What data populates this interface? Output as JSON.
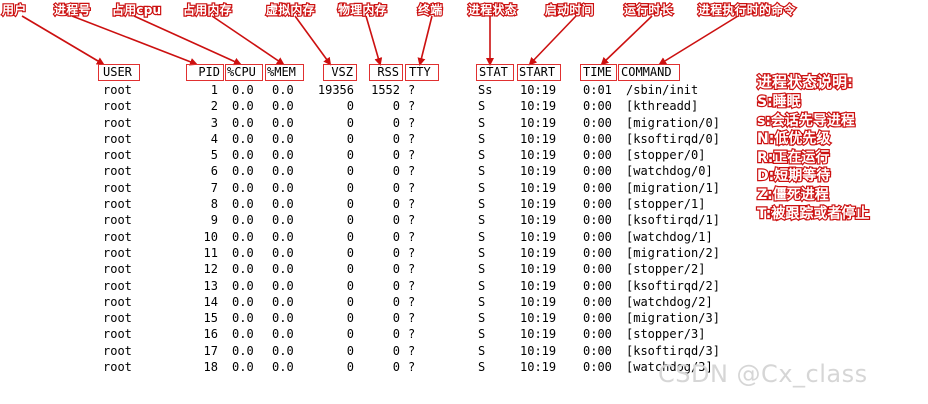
{
  "annotations": [
    "用户",
    "进程号",
    "占用cpu",
    "占用内存",
    "虚拟内存",
    "物理内存",
    "终端",
    "进程状态",
    "启动时间",
    "运行时长",
    "进程执行时的命令"
  ],
  "columns": [
    "USER",
    "PID",
    "%CPU",
    "%MEM",
    "VSZ",
    "RSS",
    "TTY",
    "STAT",
    "START",
    "TIME",
    "COMMAND"
  ],
  "rows": [
    {
      "user": "root",
      "pid": "1",
      "cpu": "0.0",
      "mem": "0.0",
      "vsz": "19356",
      "rss": "1552",
      "tty": "?",
      "stat": "Ss",
      "start": "10:19",
      "time": "0:01",
      "command": "/sbin/init"
    },
    {
      "user": "root",
      "pid": "2",
      "cpu": "0.0",
      "mem": "0.0",
      "vsz": "0",
      "rss": "0",
      "tty": "?",
      "stat": "S",
      "start": "10:19",
      "time": "0:00",
      "command": "[kthreadd]"
    },
    {
      "user": "root",
      "pid": "3",
      "cpu": "0.0",
      "mem": "0.0",
      "vsz": "0",
      "rss": "0",
      "tty": "?",
      "stat": "S",
      "start": "10:19",
      "time": "0:00",
      "command": "[migration/0]"
    },
    {
      "user": "root",
      "pid": "4",
      "cpu": "0.0",
      "mem": "0.0",
      "vsz": "0",
      "rss": "0",
      "tty": "?",
      "stat": "S",
      "start": "10:19",
      "time": "0:00",
      "command": "[ksoftirqd/0]"
    },
    {
      "user": "root",
      "pid": "5",
      "cpu": "0.0",
      "mem": "0.0",
      "vsz": "0",
      "rss": "0",
      "tty": "?",
      "stat": "S",
      "start": "10:19",
      "time": "0:00",
      "command": "[stopper/0]"
    },
    {
      "user": "root",
      "pid": "6",
      "cpu": "0.0",
      "mem": "0.0",
      "vsz": "0",
      "rss": "0",
      "tty": "?",
      "stat": "S",
      "start": "10:19",
      "time": "0:00",
      "command": "[watchdog/0]"
    },
    {
      "user": "root",
      "pid": "7",
      "cpu": "0.0",
      "mem": "0.0",
      "vsz": "0",
      "rss": "0",
      "tty": "?",
      "stat": "S",
      "start": "10:19",
      "time": "0:00",
      "command": "[migration/1]"
    },
    {
      "user": "root",
      "pid": "8",
      "cpu": "0.0",
      "mem": "0.0",
      "vsz": "0",
      "rss": "0",
      "tty": "?",
      "stat": "S",
      "start": "10:19",
      "time": "0:00",
      "command": "[stopper/1]"
    },
    {
      "user": "root",
      "pid": "9",
      "cpu": "0.0",
      "mem": "0.0",
      "vsz": "0",
      "rss": "0",
      "tty": "?",
      "stat": "S",
      "start": "10:19",
      "time": "0:00",
      "command": "[ksoftirqd/1]"
    },
    {
      "user": "root",
      "pid": "10",
      "cpu": "0.0",
      "mem": "0.0",
      "vsz": "0",
      "rss": "0",
      "tty": "?",
      "stat": "S",
      "start": "10:19",
      "time": "0:00",
      "command": "[watchdog/1]"
    },
    {
      "user": "root",
      "pid": "11",
      "cpu": "0.0",
      "mem": "0.0",
      "vsz": "0",
      "rss": "0",
      "tty": "?",
      "stat": "S",
      "start": "10:19",
      "time": "0:00",
      "command": "[migration/2]"
    },
    {
      "user": "root",
      "pid": "12",
      "cpu": "0.0",
      "mem": "0.0",
      "vsz": "0",
      "rss": "0",
      "tty": "?",
      "stat": "S",
      "start": "10:19",
      "time": "0:00",
      "command": "[stopper/2]"
    },
    {
      "user": "root",
      "pid": "13",
      "cpu": "0.0",
      "mem": "0.0",
      "vsz": "0",
      "rss": "0",
      "tty": "?",
      "stat": "S",
      "start": "10:19",
      "time": "0:00",
      "command": "[ksoftirqd/2]"
    },
    {
      "user": "root",
      "pid": "14",
      "cpu": "0.0",
      "mem": "0.0",
      "vsz": "0",
      "rss": "0",
      "tty": "?",
      "stat": "S",
      "start": "10:19",
      "time": "0:00",
      "command": "[watchdog/2]"
    },
    {
      "user": "root",
      "pid": "15",
      "cpu": "0.0",
      "mem": "0.0",
      "vsz": "0",
      "rss": "0",
      "tty": "?",
      "stat": "S",
      "start": "10:19",
      "time": "0:00",
      "command": "[migration/3]"
    },
    {
      "user": "root",
      "pid": "16",
      "cpu": "0.0",
      "mem": "0.0",
      "vsz": "0",
      "rss": "0",
      "tty": "?",
      "stat": "S",
      "start": "10:19",
      "time": "0:00",
      "command": "[stopper/3]"
    },
    {
      "user": "root",
      "pid": "17",
      "cpu": "0.0",
      "mem": "0.0",
      "vsz": "0",
      "rss": "0",
      "tty": "?",
      "stat": "S",
      "start": "10:19",
      "time": "0:00",
      "command": "[ksoftirqd/3]"
    },
    {
      "user": "root",
      "pid": "18",
      "cpu": "0.0",
      "mem": "0.0",
      "vsz": "0",
      "rss": "0",
      "tty": "?",
      "stat": "S",
      "start": "10:19",
      "time": "0:00",
      "command": "[watchdog/3]"
    }
  ],
  "legend": {
    "title": "进程状态说明:",
    "items": [
      "S:睡眠",
      "s:会话先导进程",
      "N:低优先级",
      "R:正在运行",
      "D:短期等待",
      "Z:僵死进程",
      "T:被跟踪或者停止"
    ]
  },
  "watermark": "CSDN @Cx_class",
  "colors": {
    "annotation": "#cc1010",
    "header_box": "#e03030",
    "text": "#000000",
    "background": "#ffffff"
  }
}
